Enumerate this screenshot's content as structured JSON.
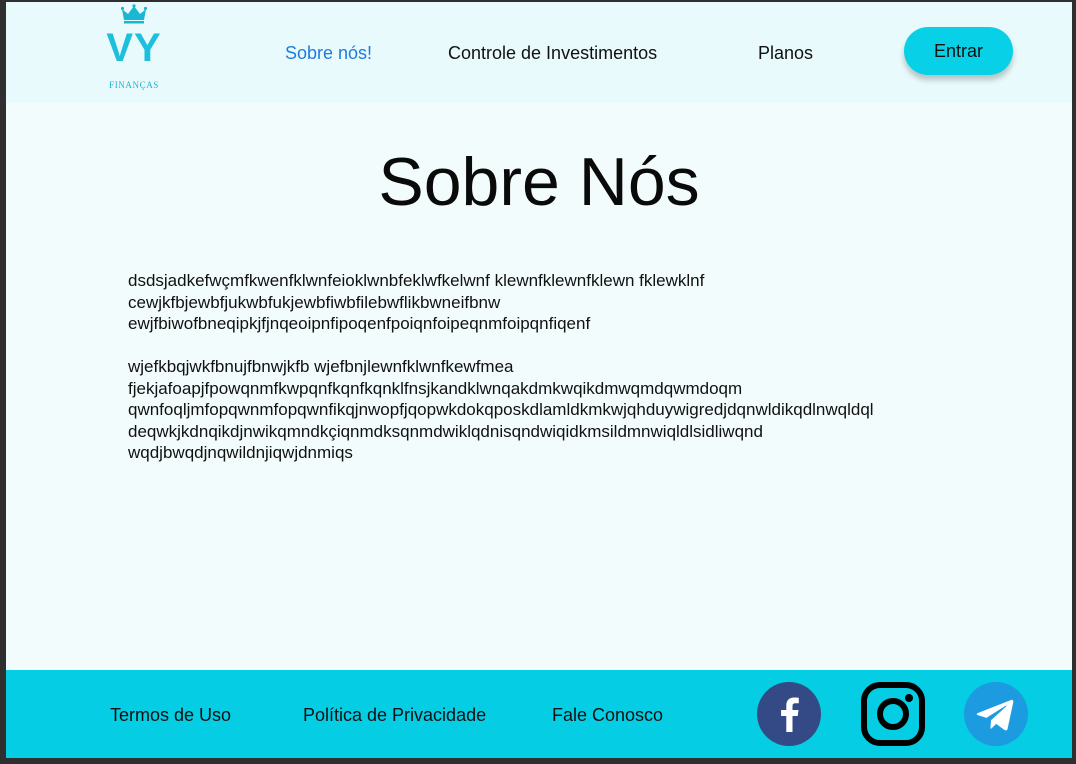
{
  "header": {
    "logo": {
      "mark": "VY",
      "subtitle": "FINANÇAS"
    },
    "nav": [
      {
        "label": "Sobre nós!",
        "active": true
      },
      {
        "label": "Controle de Investimentos",
        "active": false
      },
      {
        "label": "Planos",
        "active": false
      }
    ],
    "login_label": "Entrar"
  },
  "main": {
    "title": "Sobre Nós",
    "paragraphs": [
      [
        "dsdsjadkefwçmfkwenfklwnfeioklwnbfeklwfkelwnf klewnfklewnfklewn fklewklnf",
        "cewjkfbjewbfjukwbfukjewbfiwbfilebwflikbwneifbnw",
        "ewjfbiwofbneqipkjfjnqeoipnfipoqenfpoiqnfoipeqnmfoipqnfiqenf"
      ],
      [
        "wjefkbqjwkfbnujfbnwjkfb wjefbnjlewnfklwnfkewfmea",
        "fjekjafoapjfpowqnmfkwpqnfkqnfkqnklfnsjkandklwnqakdmkwqikdmwqmdqwmdoqm",
        "qwnfoqljmfopqwnmfopqwnfikqjnwopfjqopwkdokqposkdlamldkmkwjqhduywigredjdqnwldikqdlnwqldql",
        "deqwkjkdnqikdjnwikqmndkçiqnmdksqnmdwiklqdnisqndwiqidkmsildmnwiqldlsidliwqnd",
        "wqdjbwqdjnqwildnjiqwjdnmiqs"
      ]
    ]
  },
  "footer": {
    "links": [
      "Termos de Uso",
      "Política de Privacidade",
      "Fale Conosco"
    ],
    "social": [
      "facebook-icon",
      "instagram-icon",
      "telegram-icon"
    ]
  },
  "colors": {
    "accent": "#05cde4",
    "header_bg": "#e8fafb",
    "page_bg": "#f2fcfc",
    "active_link": "#1f7be0",
    "facebook": "#334a86",
    "telegram": "#1d9be0"
  }
}
